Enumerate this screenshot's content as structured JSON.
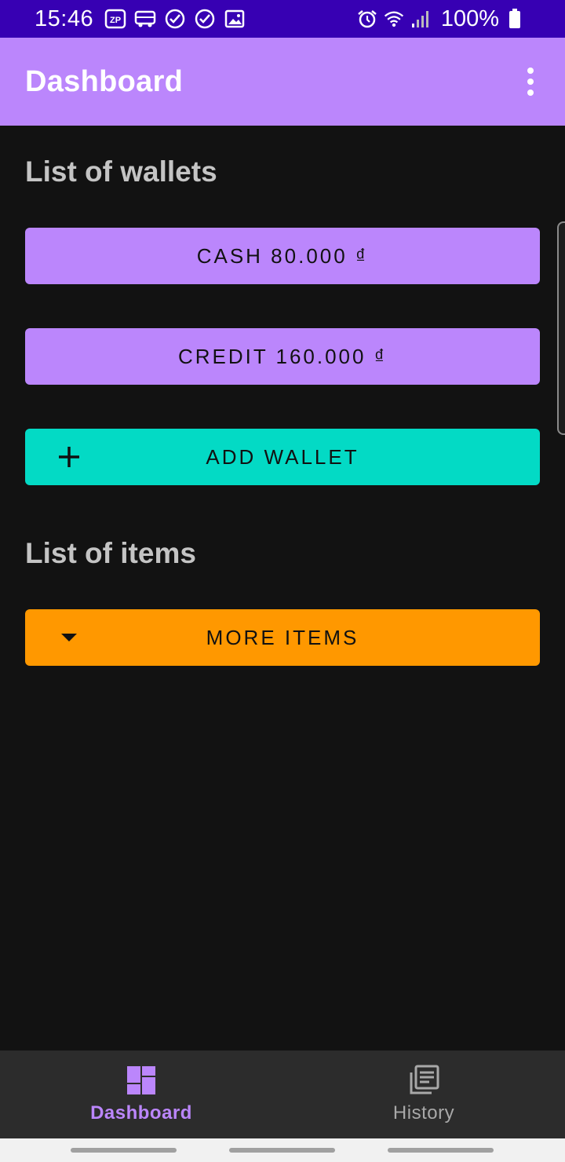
{
  "status_bar": {
    "time": "15:46",
    "battery_text": "100%",
    "left_icons": [
      "zalopay-icon",
      "bus-icon",
      "check-circle-icon",
      "check-circle-icon",
      "image-icon"
    ],
    "right_icons": [
      "alarm-icon",
      "wifi-icon",
      "signal-icon",
      "battery-icon"
    ]
  },
  "app_bar": {
    "title": "Dashboard",
    "menu_icon": "more-vert-icon"
  },
  "wallets": {
    "title": "List of wallets",
    "items": [
      {
        "label": "CASH 80.000 ₫"
      },
      {
        "label": "CREDIT 160.000 ₫"
      }
    ],
    "add_label": "ADD WALLET"
  },
  "items": {
    "title": "List of items",
    "more_label": "MORE ITEMS"
  },
  "bottom_nav": {
    "items": [
      {
        "label": "Dashboard",
        "icon": "dashboard-icon",
        "active": true
      },
      {
        "label": "History",
        "icon": "history-icon",
        "active": false
      }
    ]
  },
  "colors": {
    "primary": "#bb86fc",
    "primary_dark": "#3700b3",
    "secondary": "#03dac5",
    "orange": "#ff9800",
    "background": "#121212"
  }
}
